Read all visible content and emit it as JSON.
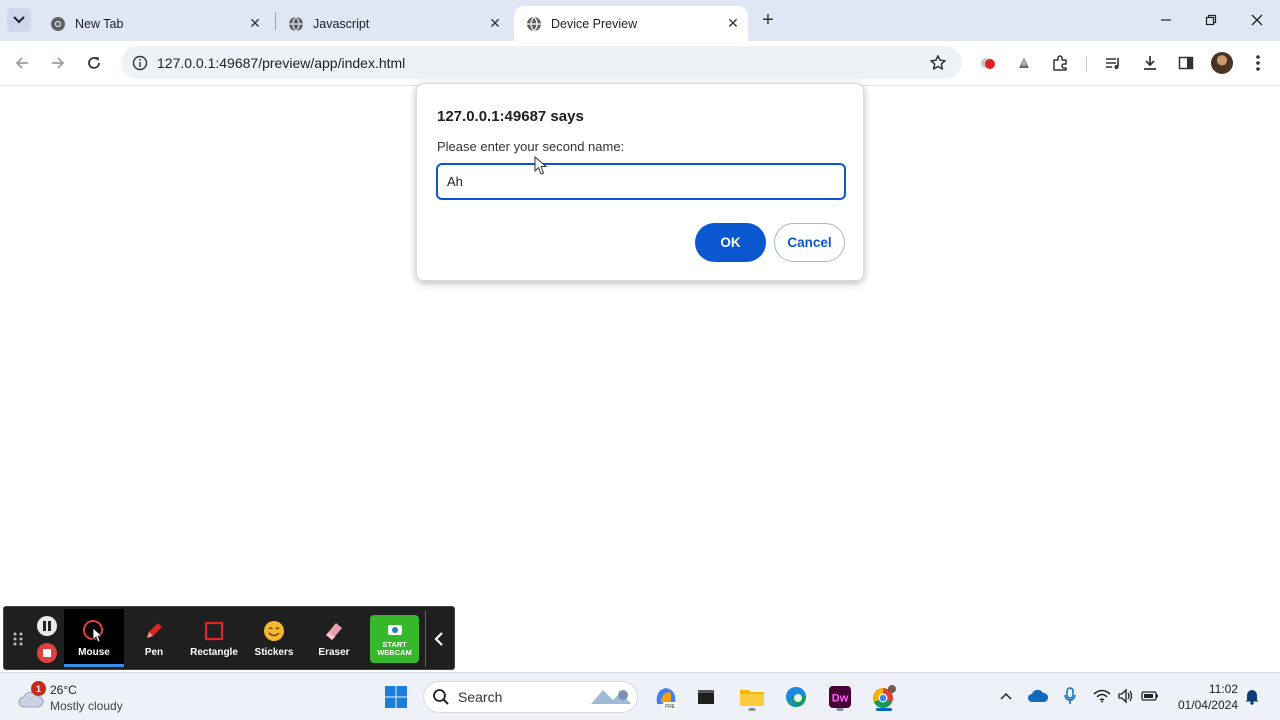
{
  "browser": {
    "tabs": [
      {
        "title": "New Tab",
        "favicon": "chrome-icon"
      },
      {
        "title": "Javascript",
        "favicon": "globe-icon"
      },
      {
        "title": "Device Preview",
        "favicon": "globe-icon",
        "active": true
      }
    ],
    "url": "127.0.0.1:49687/preview/app/index.html"
  },
  "dialog": {
    "title": "127.0.0.1:49687 says",
    "message": "Please enter your second name:",
    "input_value": "Ah",
    "ok_label": "OK",
    "cancel_label": "Cancel"
  },
  "recorder": {
    "tools": [
      {
        "label": "Mouse",
        "icon": "mouse-icon",
        "active": true
      },
      {
        "label": "Pen",
        "icon": "pen-icon"
      },
      {
        "label": "Rectangle",
        "icon": "rectangle-icon"
      },
      {
        "label": "Stickers",
        "icon": "sticker-icon"
      },
      {
        "label": "Eraser",
        "icon": "eraser-icon"
      }
    ],
    "webcam_label_line1": "START",
    "webcam_label_line2": "WEBCAM"
  },
  "taskbar": {
    "weather": {
      "badge": "1",
      "temp": "26°C",
      "condition": "Mostly cloudy"
    },
    "search_placeholder": "Search",
    "time": "11:02",
    "date": "01/04/2024"
  },
  "colors": {
    "accent": "#0b57d0",
    "tabstrip": "#dfe7f5",
    "recorder_bg": "#1f1f1f",
    "webcam_green": "#37b82c"
  }
}
